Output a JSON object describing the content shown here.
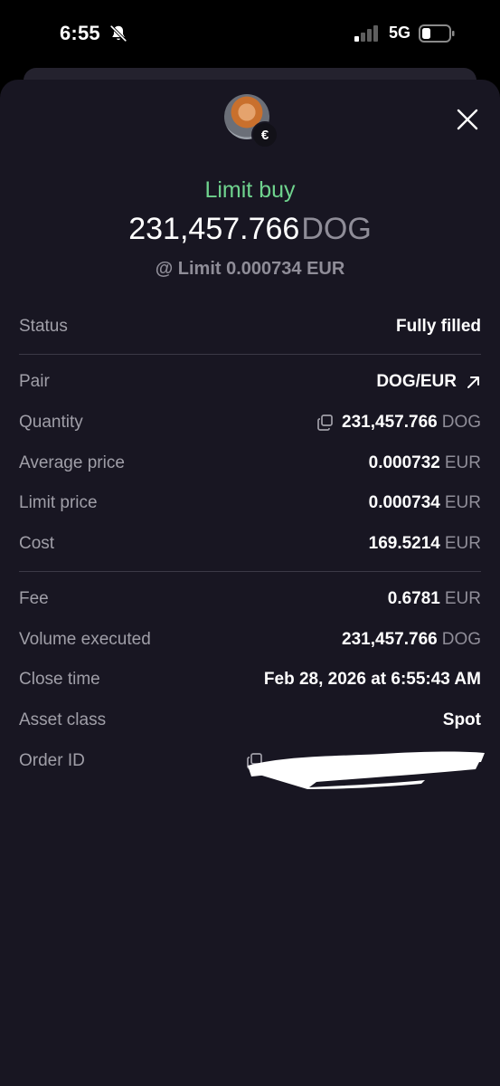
{
  "status_bar": {
    "time": "6:55",
    "network": "5G"
  },
  "header": {
    "order_type": "Limit buy",
    "amount": "231,457.766",
    "asset": "DOG",
    "limit_text": "@ Limit 0.000734 EUR",
    "badge_symbol": "€"
  },
  "details": {
    "status": {
      "label": "Status",
      "value": "Fully filled"
    },
    "pair": {
      "label": "Pair",
      "value": "DOG/EUR"
    },
    "quantity": {
      "label": "Quantity",
      "value": "231,457.766",
      "unit": "DOG"
    },
    "average_price": {
      "label": "Average price",
      "value": "0.000732",
      "unit": "EUR"
    },
    "limit_price": {
      "label": "Limit price",
      "value": "0.000734",
      "unit": "EUR"
    },
    "cost": {
      "label": "Cost",
      "value": "169.5214",
      "unit": "EUR"
    },
    "fee": {
      "label": "Fee",
      "value": "0.6781",
      "unit": "EUR"
    },
    "volume_executed": {
      "label": "Volume executed",
      "value": "231,457.766",
      "unit": "DOG"
    },
    "close_time": {
      "label": "Close time",
      "value": "Feb 28, 2026 at 6:55:43 AM"
    },
    "asset_class": {
      "label": "Asset class",
      "value": "Spot"
    },
    "order_id": {
      "label": "Order ID"
    }
  },
  "colors": {
    "accent_green": "#6fd38e",
    "sheet_bg": "#181622",
    "muted": "#8f8d98"
  },
  "icons": [
    "bell-muted-icon",
    "signal-icon",
    "battery-icon",
    "close-icon",
    "copy-icon",
    "external-link-icon"
  ]
}
